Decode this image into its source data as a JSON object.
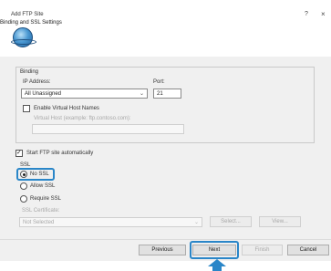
{
  "window": {
    "title": "Add FTP Site",
    "help_glyph": "?",
    "close_glyph": "×"
  },
  "header": {
    "title": "Binding and SSL Settings",
    "icon": "globe-icon"
  },
  "binding": {
    "group_label": "Binding",
    "ip_label": "IP Address:",
    "ip_value": "All Unassigned",
    "port_label": "Port:",
    "port_value": "21",
    "virtual_host_checkbox_label": "Enable Virtual Host Names",
    "virtual_host_checked": false,
    "virtual_host_label": "Virtual Host (example: ftp.contoso.com):",
    "virtual_host_value": ""
  },
  "start_automatically": {
    "label": "Start FTP site automatically",
    "checked": true
  },
  "ssl": {
    "group_label": "SSL",
    "options": [
      {
        "label": "No SSL",
        "selected": true
      },
      {
        "label": "Allow SSL",
        "selected": false
      },
      {
        "label": "Require SSL",
        "selected": false
      }
    ],
    "certificate_label": "SSL Certificate:",
    "certificate_value": "Not Selected",
    "select_button": "Select...",
    "view_button": "View..."
  },
  "footer": {
    "previous": "Previous",
    "next": "Next",
    "finish": "Finish",
    "cancel": "Cancel"
  },
  "colors": {
    "highlight": "#2a86c8",
    "dialog_bg": "#f0f0f0"
  }
}
